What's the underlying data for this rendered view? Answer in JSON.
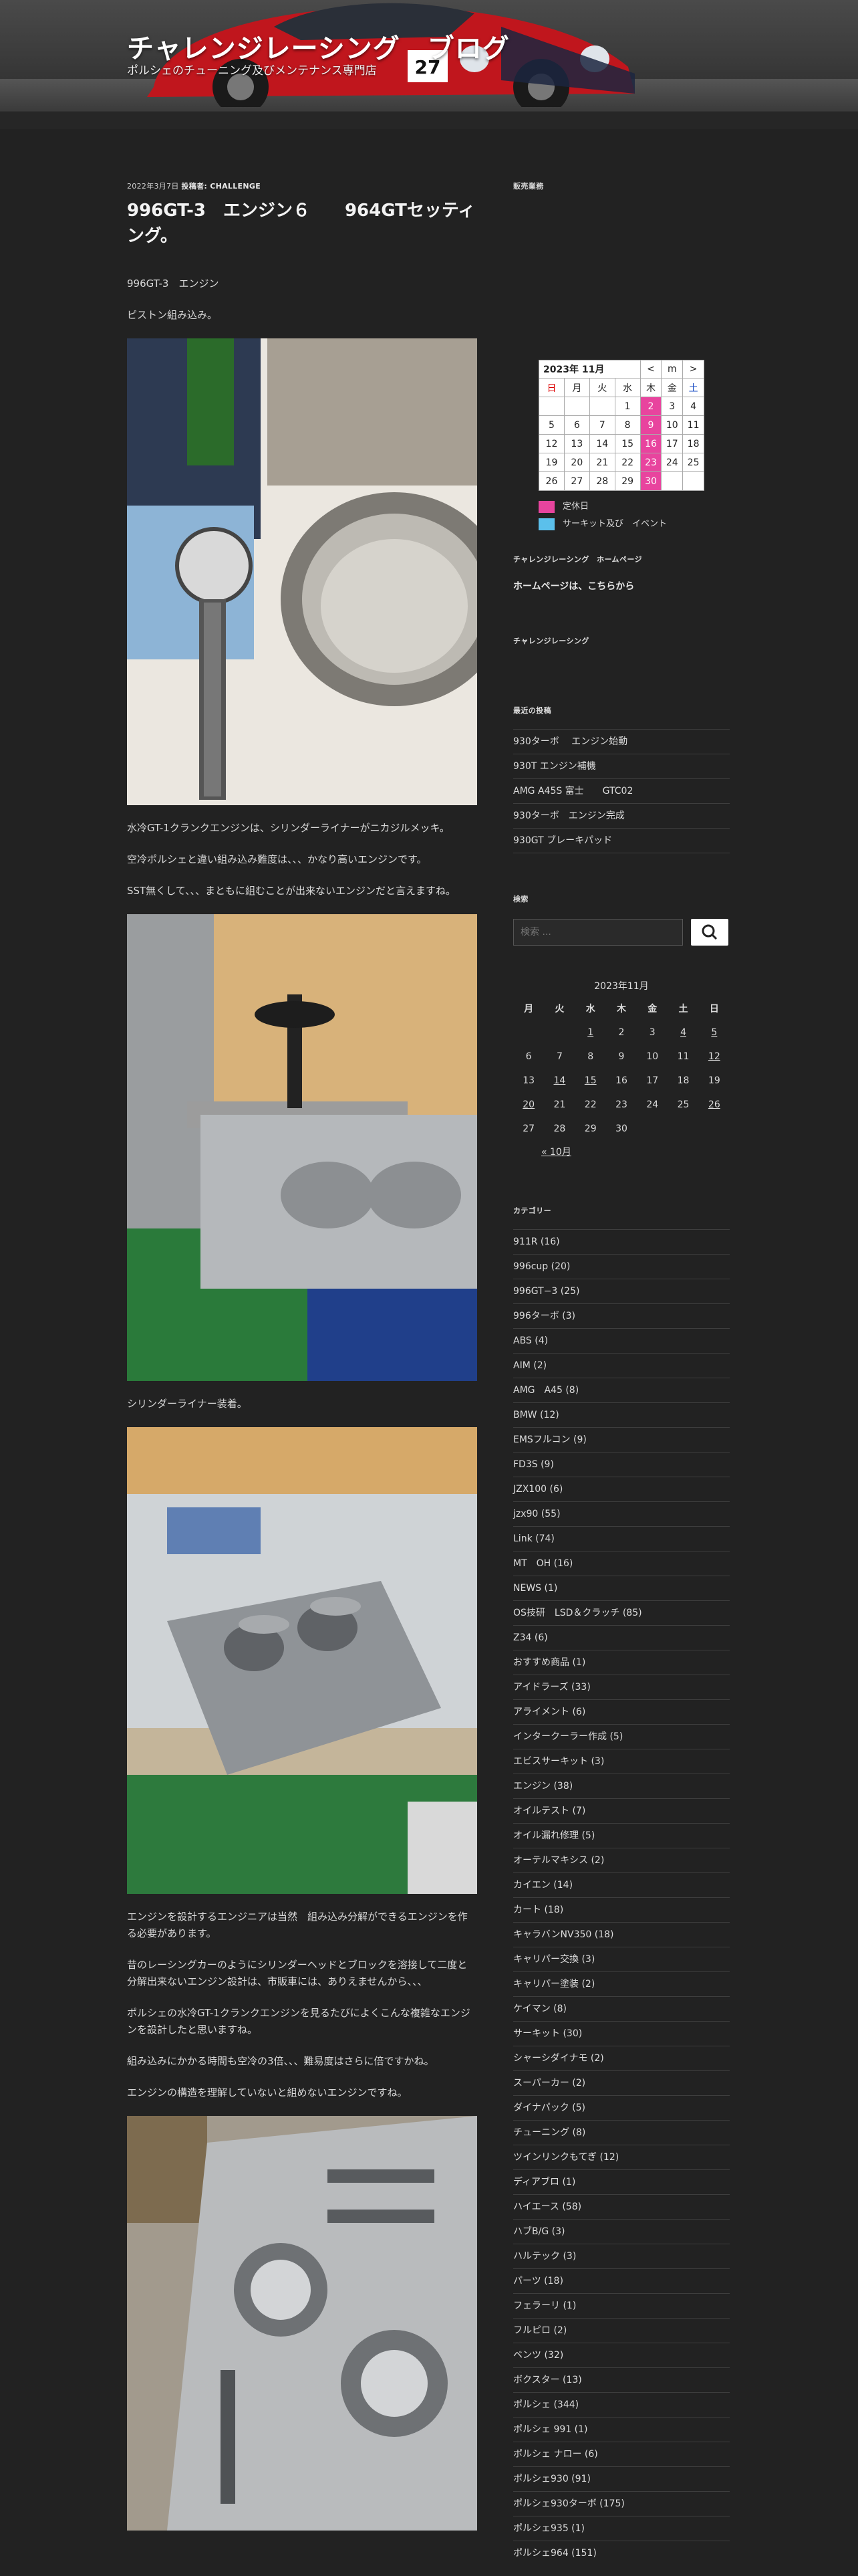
{
  "header": {
    "title": "チャレンジレーシング　ブログ",
    "description": "ポルシェのチューニング及びメンテナンス専門店",
    "car_number": "27"
  },
  "post": {
    "meta_date": "2022年3月7日",
    "meta_category_label": "投稿者: CHALLENGE",
    "title": "996GT-3　エンジン６　　964GTセッティング。",
    "p1": "996GT-3　エンジン",
    "p2": "ピストン組み込み。",
    "p3": "水冷GT-1クランクエンジンは、シリンダーライナーがニカジルメッキ。",
    "p4": "空冷ポルシェと違い組み込み難度は、、、かなり高いエンジンです。",
    "p5": "SST無くして、、、まともに組むことが出来ないエンジンだと言えますね。",
    "p6": "シリンダーライナー装着。",
    "p7": "エンジンを設計するエンジニアは当然　組み込み分解ができるエンジンを作る必要があります。",
    "p8": "昔のレーシングカーのようにシリンダーヘッドとブロックを溶接して二度と分解出来ないエンジン設計は、市販車には、ありえませんから、、、",
    "p9": "ポルシェの水冷GT-1クランクエンジンを見るたびによくこんな複雑なエンジンを設計したと思いますね。",
    "p10": "組み込みにかかる時間も空冷の3倍、、、難易度はさらに倍ですかね。",
    "p11": "エンジンの構造を理解していないと組めないエンジンですね。"
  },
  "sidebar": {
    "business_calendar_title": "販売業務",
    "biz_month": "2023年 11月",
    "biz_prev": "<",
    "biz_next": ">",
    "biz_month_short": "m",
    "biz_days": [
      "日",
      "月",
      "火",
      "水",
      "木",
      "金",
      "土"
    ],
    "biz_weeks": [
      [
        "",
        "",
        "",
        "1",
        "2",
        "3",
        "4"
      ],
      [
        "5",
        "6",
        "7",
        "8",
        "9",
        "10",
        "11"
      ],
      [
        "12",
        "13",
        "14",
        "15",
        "16",
        "17",
        "18"
      ],
      [
        "19",
        "20",
        "21",
        "22",
        "23",
        "24",
        "25"
      ],
      [
        "26",
        "27",
        "28",
        "29",
        "30",
        "",
        ""
      ]
    ],
    "legend_holiday": "定休日",
    "legend_event": "サーキット及び　イベント",
    "homepage_title": "チャレンジレーシング　ホームページ",
    "homepage_link": "ホームページは、こちらから",
    "challenge_title": "チャレンジレーシング",
    "recent_title": "最近の投稿",
    "recent_posts": [
      "930ターボ　 エンジン始動",
      "930T エンジン補機",
      "AMG A45S 富士　　GTC02",
      "930ターボ　エンジン完成",
      "930GT ブレーキパッド"
    ],
    "search_title": "検索",
    "search_placeholder": "検索 ...",
    "cal_caption": "2023年11月",
    "cal_days": [
      "月",
      "火",
      "水",
      "木",
      "金",
      "土",
      "日"
    ],
    "cal_weeks": [
      [
        "",
        "",
        "1",
        "2",
        "3",
        "4",
        "5"
      ],
      [
        "6",
        "7",
        "8",
        "9",
        "10",
        "11",
        "12"
      ],
      [
        "13",
        "14",
        "15",
        "16",
        "17",
        "18",
        "19"
      ],
      [
        "20",
        "21",
        "22",
        "23",
        "24",
        "25",
        "26"
      ],
      [
        "27",
        "28",
        "29",
        "30",
        "",
        "",
        ""
      ]
    ],
    "cal_prev": "« 10月",
    "categories_title": "カテゴリー",
    "categories": [
      "911R (16)",
      "996cup (20)",
      "996GT−3 (25)",
      "996ターボ (3)",
      "ABS (4)",
      "AIM (2)",
      "AMG　A45 (8)",
      "BMW (12)",
      "EMSフルコン (9)",
      "FD3S (9)",
      "JZX100 (6)",
      "jzx90 (55)",
      "Link (74)",
      "MT　OH (16)",
      "NEWS (1)",
      "OS技研　LSD＆クラッチ (85)",
      "Z34 (6)",
      "おすすめ商品 (1)",
      "アイドラーズ (33)",
      "アライメント (6)",
      "インタークーラー作成 (5)",
      "エビスサーキット (3)",
      "エンジン (38)",
      "オイルテスト (7)",
      "オイル漏れ修理 (5)",
      "オーテルマキシス (2)",
      "カイエン (14)",
      "カート (18)",
      "キャラバンNV350 (18)",
      "キャリパー交換 (3)",
      "キャリパー塗装 (2)",
      "ケイマン (8)",
      "サーキット (30)",
      "シャーシダイナモ (2)",
      "スーパーカー (2)",
      "ダイナパック (5)",
      "チューニング (8)",
      "ツインリンクもてぎ (12)",
      "ディアブロ (1)",
      "ハイエース (58)",
      "ハブB/G (3)",
      "ハルテック (3)",
      "パーツ (18)",
      "フェラーリ (1)",
      "フルピロ (2)",
      "ベンツ (32)",
      "ボクスター (13)",
      "ポルシェ (344)",
      "ポルシェ 991 (1)",
      "ポルシェ ナロー (6)",
      "ポルシェ930 (91)",
      "ポルシェ930ターボ (175)",
      "ポルシェ935 (1)",
      "ポルシェ964 (151)"
    ],
    "colors": {
      "holiday": "#e8449e",
      "event": "#5bc0eb"
    }
  }
}
